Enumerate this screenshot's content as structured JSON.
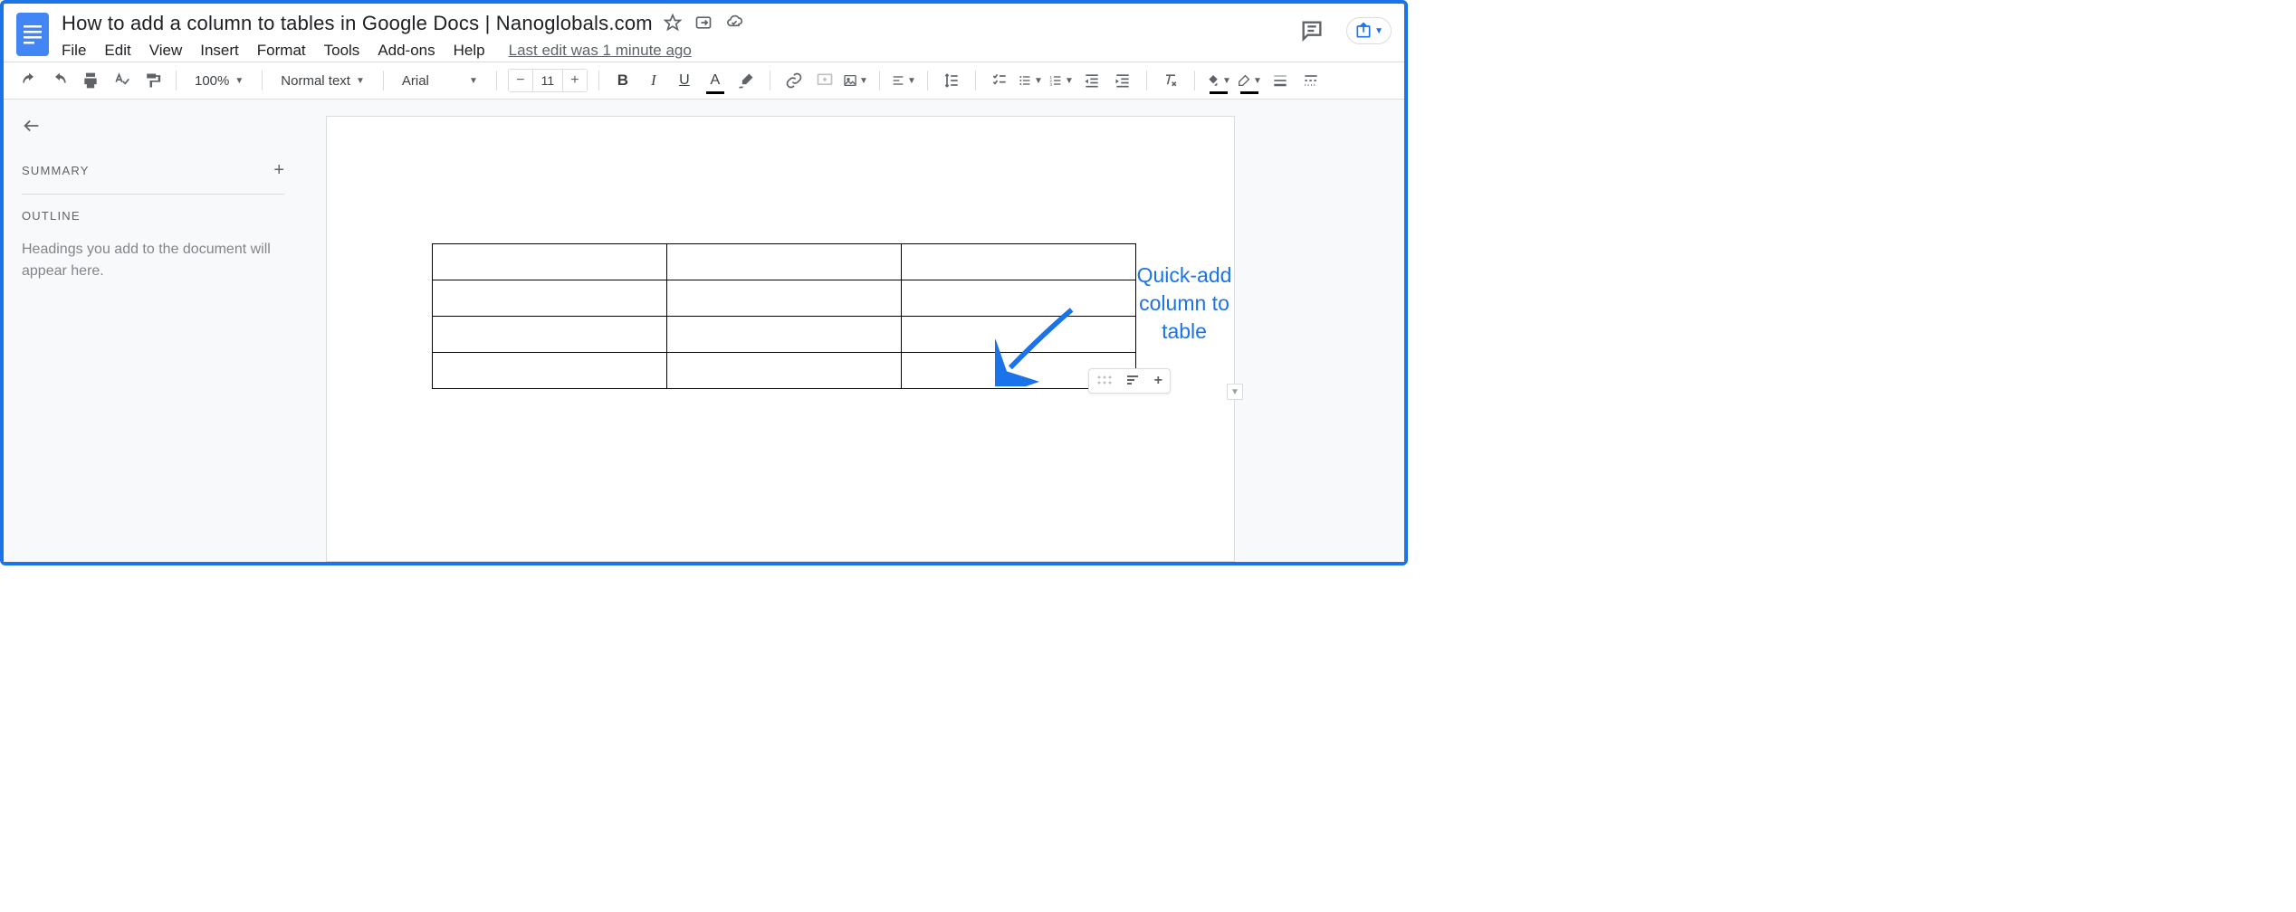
{
  "document": {
    "title": "How to add a column to tables in Google Docs | Nanoglobals.com"
  },
  "menubar": {
    "items": [
      "File",
      "Edit",
      "View",
      "Insert",
      "Format",
      "Tools",
      "Add-ons",
      "Help"
    ],
    "last_edit": "Last edit was 1 minute ago"
  },
  "toolbar": {
    "zoom": "100%",
    "style": "Normal text",
    "font": "Arial",
    "font_size": "11"
  },
  "sidebar": {
    "summary_label": "SUMMARY",
    "outline_label": "OUTLINE",
    "outline_hint": "Headings you add to the document will appear here."
  },
  "table": {
    "rows": 4,
    "cols": 3
  },
  "annotation": {
    "text_line1": "Quick-add",
    "text_line2": "column to",
    "text_line3": "table"
  }
}
